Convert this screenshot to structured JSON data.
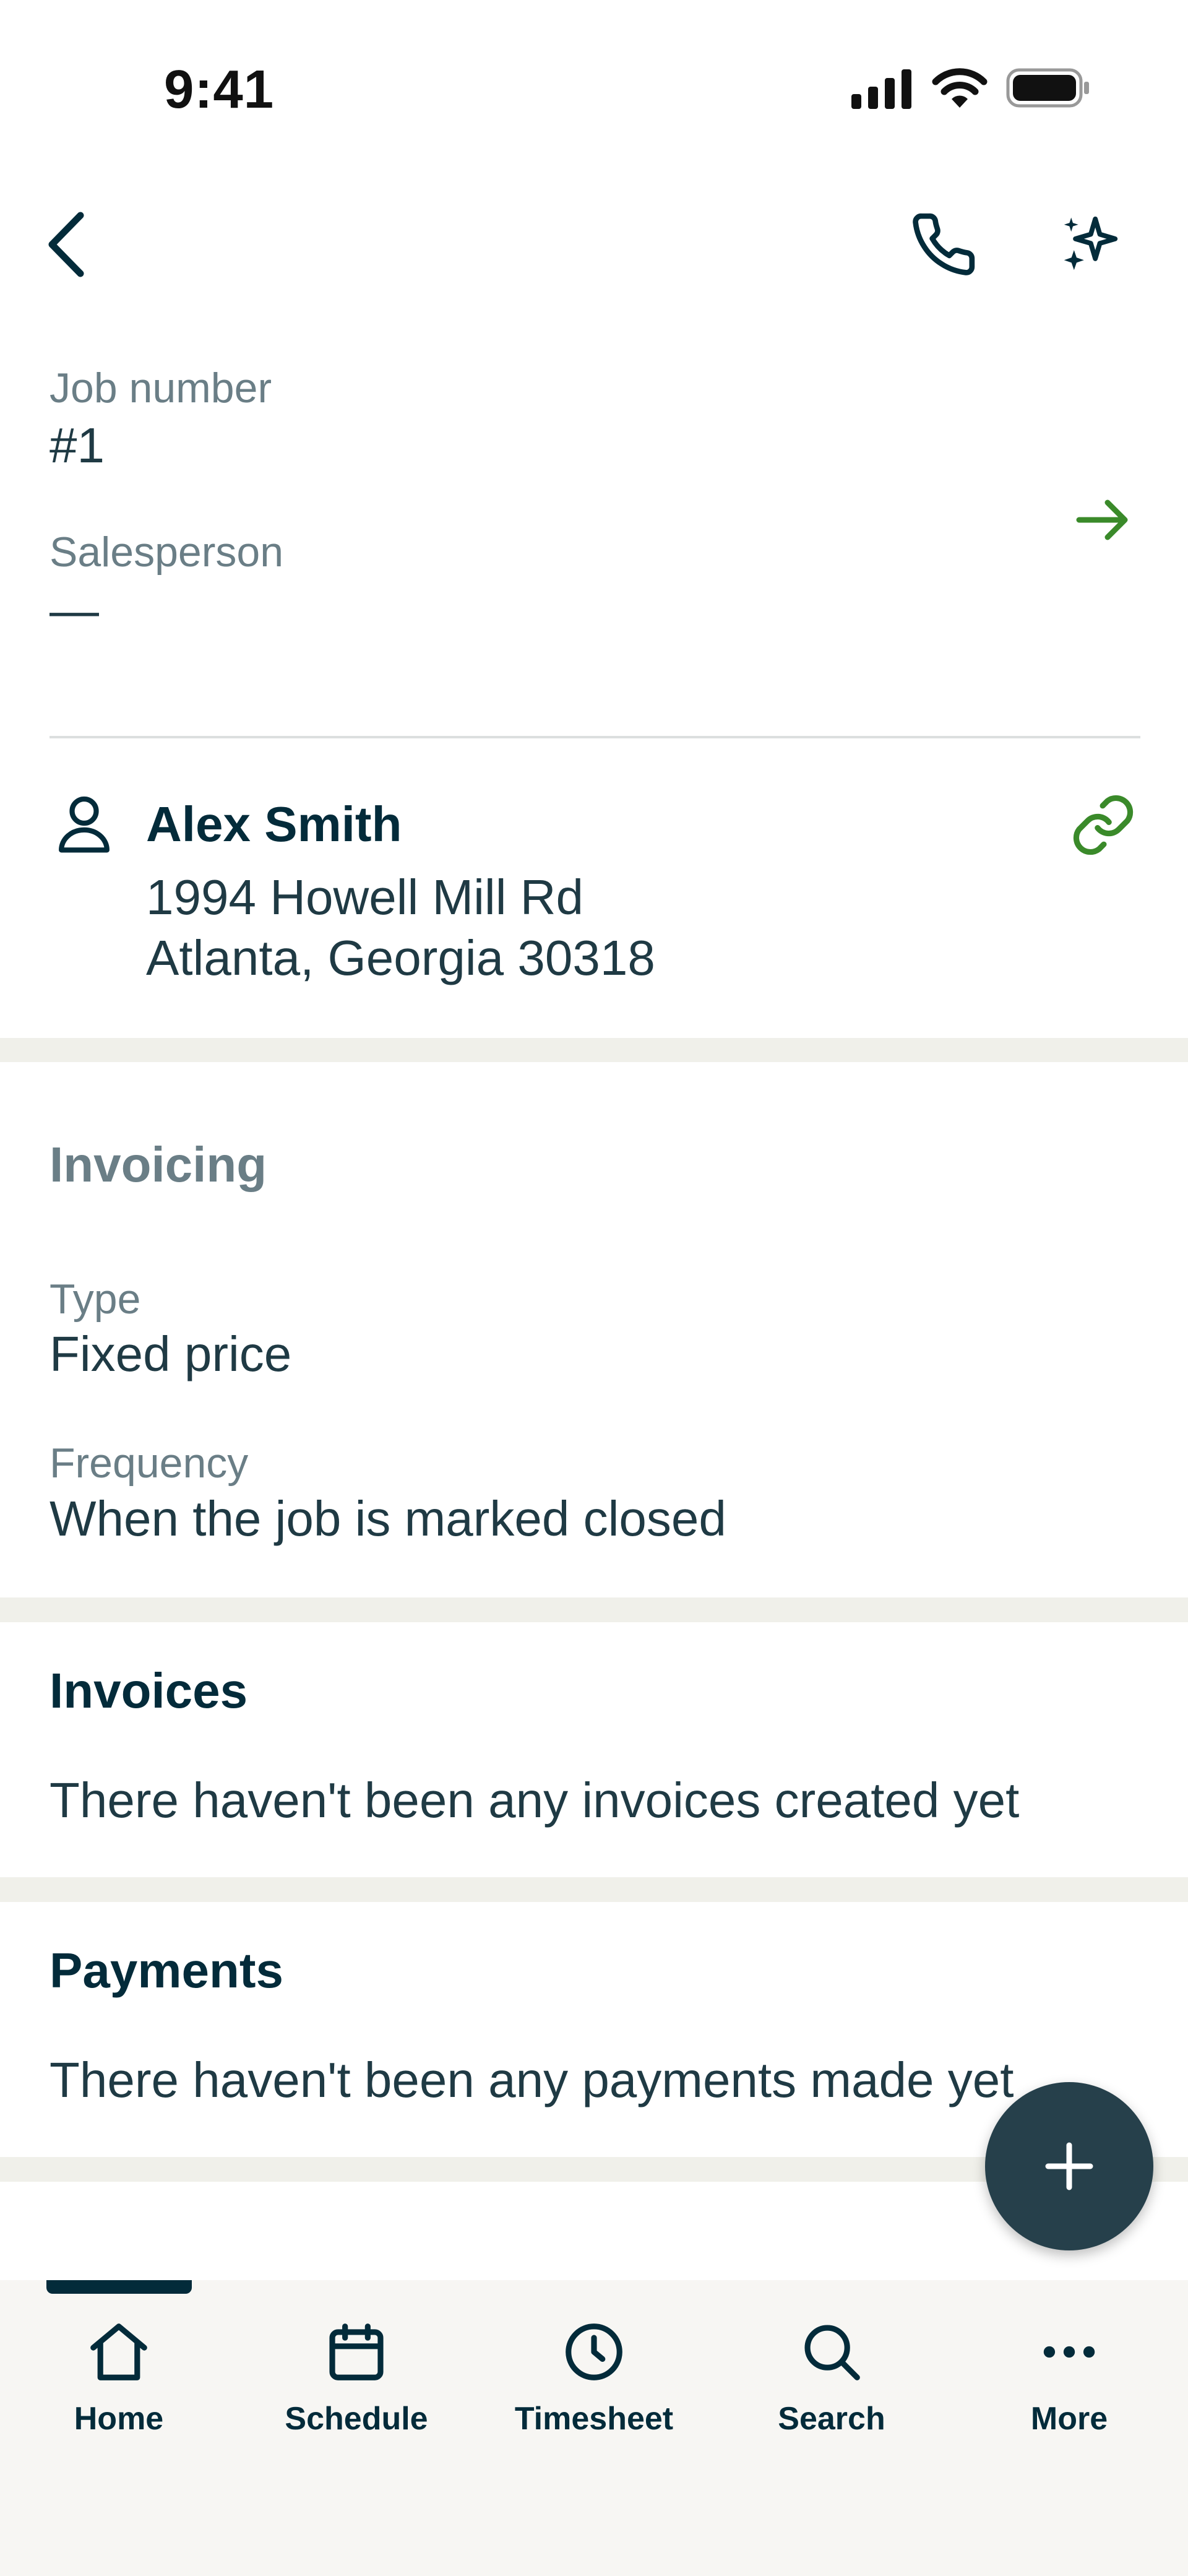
{
  "status_bar": {
    "time": "9:41"
  },
  "job": {
    "job_number_label": "Job number",
    "job_number_value": "#1",
    "salesperson_label": "Salesperson",
    "salesperson_value": "—"
  },
  "client": {
    "name": "Alex Smith",
    "address_line1": "1994 Howell Mill Rd",
    "address_line2": "Atlanta, Georgia 30318"
  },
  "invoicing": {
    "section_title": "Invoicing",
    "type_label": "Type",
    "type_value": "Fixed price",
    "frequency_label": "Frequency",
    "frequency_value": "When the job is marked closed"
  },
  "invoices": {
    "title": "Invoices",
    "empty_text": "There haven't been any invoices created yet"
  },
  "payments": {
    "title": "Payments",
    "empty_text": "There haven't been any payments made yet"
  },
  "bottom_nav": {
    "items": [
      {
        "label": "Home",
        "icon": "home-icon",
        "active": true
      },
      {
        "label": "Schedule",
        "icon": "calendar-icon"
      },
      {
        "label": "Timesheet",
        "icon": "clock-icon"
      },
      {
        "label": "Search",
        "icon": "search-icon"
      },
      {
        "label": "More",
        "icon": "more-icon"
      }
    ]
  },
  "colors": {
    "primary_dark": "#032b3a",
    "accent_green": "#3a8a2a",
    "muted_label": "#6a7e86",
    "section_band": "#f0f0ea",
    "fab": "#26404b"
  }
}
